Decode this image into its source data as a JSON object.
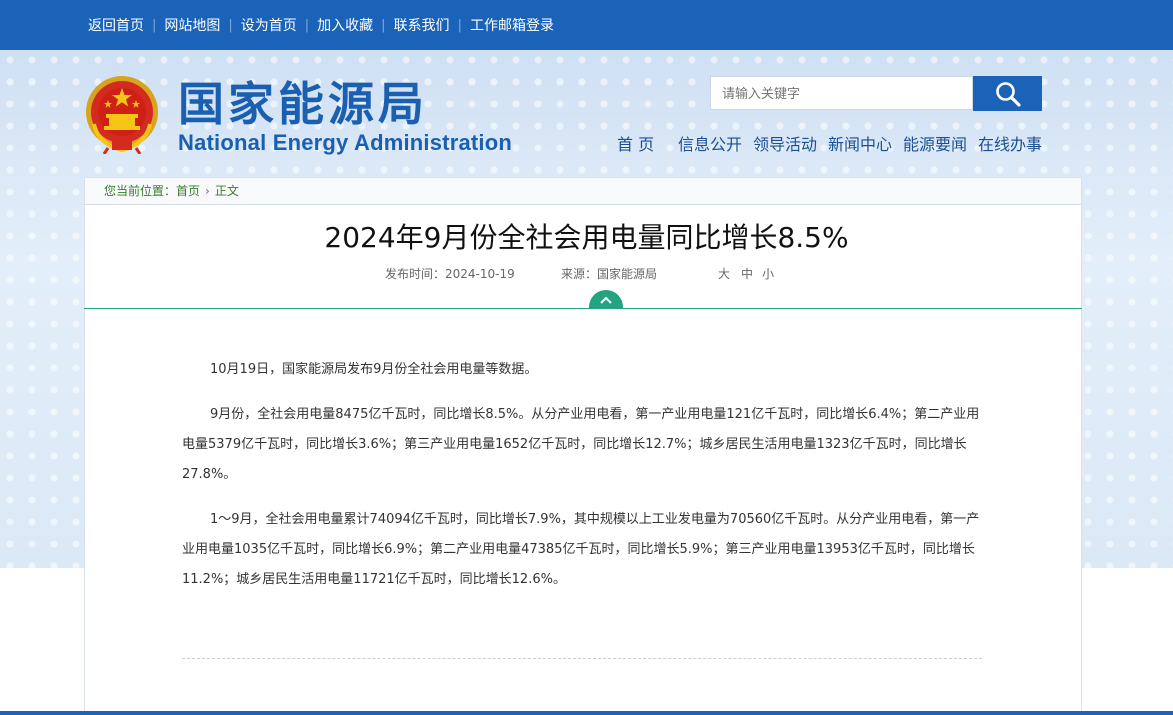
{
  "topbar": {
    "links": [
      "返回首页",
      "网站地图",
      "设为首页",
      "加入收藏",
      "联系我们",
      "工作邮箱登录"
    ]
  },
  "header": {
    "logo_cn": "国家能源局",
    "logo_en": "National Energy Administration",
    "search_placeholder": "请输入关键字",
    "nav": [
      "首 页",
      "信息公开",
      "领导活动",
      "新闻中心",
      "能源要闻",
      "在线办事"
    ]
  },
  "breadcrumb": {
    "prefix": "您当前位置：",
    "home": "首页",
    "current": "正文"
  },
  "article": {
    "title": "2024年9月份全社会用电量同比增长8.5%",
    "publish_time": "发布时间：2024-10-19",
    "source": "来源：国家能源局",
    "font_sizes": [
      "大",
      "中",
      "小"
    ],
    "paragraphs": [
      "10月19日，国家能源局发布9月份全社会用电量等数据。",
      "9月份，全社会用电量8475亿千瓦时，同比增长8.5%。从分产业用电看，第一产业用电量121亿千瓦时，同比增长6.4%；第二产业用电量5379亿千瓦时，同比增长3.6%；第三产业用电量1652亿千瓦时，同比增长12.7%；城乡居民生活用电量1323亿千瓦时，同比增长27.8%。",
      "1～9月，全社会用电量累计74094亿千瓦时，同比增长7.9%，其中规模以上工业发电量为70560亿千瓦时。从分产业用电看，第一产业用电量1035亿千瓦时，同比增长6.9%；第二产业用电量47385亿千瓦时，同比增长5.9%；第三产业用电量13953亿千瓦时，同比增长11.2%；城乡居民生活用电量11721亿千瓦时，同比增长12.6%。"
    ]
  },
  "colors": {
    "primary_blue": "#1a63b8",
    "logo_blue": "#1a5fb0",
    "accent_green": "#23a37f",
    "breadcrumb_green": "#3c7a2a"
  }
}
